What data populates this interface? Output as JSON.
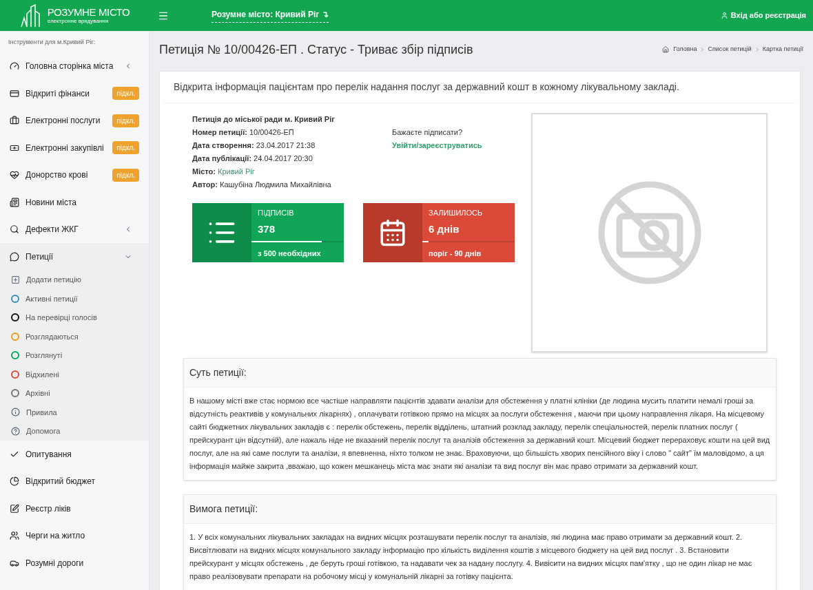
{
  "header": {
    "logo_title": "РОЗУМНЕ МІСТО",
    "logo_subtitle": "електронне врядування",
    "city_selector": "Розумне місто: Кривий Ріг",
    "city_selector_arrow": "↴",
    "login": "Вхід або реєстрація"
  },
  "sidebar": {
    "caption": "Інструменти для м.Кривий Ріг:",
    "items": [
      {
        "label": "Головна сторінка міста",
        "expanded": false
      },
      {
        "label": "Відкриті фінанси",
        "badge": "підкл."
      },
      {
        "label": "Електронні послуги",
        "badge": "підкл."
      },
      {
        "label": "Електронні закупівлі",
        "badge": "підкл."
      },
      {
        "label": "Донорство крові",
        "badge": "підкл."
      },
      {
        "label": "Новини міста"
      },
      {
        "label": "Дефекти ЖКГ",
        "expanded": false
      },
      {
        "label": "Петиції",
        "expanded": true,
        "children": [
          {
            "kind": "add",
            "label": "Додати петицію"
          },
          {
            "kind": "status",
            "label": "Активні петиції",
            "color": "#3c8dbc"
          },
          {
            "kind": "status",
            "label": "На перевірці голосів",
            "color": "#111111"
          },
          {
            "kind": "status",
            "label": "Розглядаються",
            "color": "#f39c12"
          },
          {
            "kind": "status",
            "label": "Розглянуті",
            "color": "#00a65a"
          },
          {
            "kind": "status",
            "label": "Відхилені",
            "color": "#dd4b39"
          },
          {
            "kind": "status",
            "label": "Архівні",
            "color": "#777777"
          },
          {
            "kind": "info",
            "label": "Привила"
          },
          {
            "kind": "help",
            "label": "Допомога"
          }
        ]
      },
      {
        "label": "Опитування"
      },
      {
        "label": "Відкритий бюджет"
      },
      {
        "label": "Реєстр ліків"
      },
      {
        "label": "Черги на житло"
      },
      {
        "label": "Розумні дороги"
      }
    ]
  },
  "page": {
    "title": "Петиція № 10/00426-ЕП . Статус - Триває збір підписів",
    "breadcrumbs": [
      "Головна",
      "Список петицій",
      "Картка петиції"
    ]
  },
  "petition": {
    "heading": "Відкрита інформація пацієнтам про перелік надання послуг за державний кошт в кожному лікувальному закладі.",
    "addressee": "Петиція до міської ради м. Кривий Ріг",
    "fields": [
      {
        "label": "Номер петиції:",
        "value": "10/00426-ЕП",
        "link": false
      },
      {
        "label": "Дата створення:",
        "value": "23.04.2017 21:38",
        "link": false
      },
      {
        "label": "Дата публікації:",
        "value": "24.04.2017 20:30",
        "link": false
      },
      {
        "label": "Місто:",
        "value": "Кривий Ріг",
        "link": true
      },
      {
        "label": "Автор:",
        "value": "Кашубіна Людмила Михайлівна",
        "link": false
      }
    ],
    "sign_prompt": "Бажаєте підписати?",
    "sign_link": "Увійти/зареєструватись",
    "stats": [
      {
        "kind": "signatures",
        "title": "ПІДПИСІВ",
        "value": "378",
        "level": 0.76,
        "note": "з 500 необхідних"
      },
      {
        "kind": "days",
        "title": "ЗАЛИШИЛОСЬ",
        "value": "6 днів",
        "level": 0.07,
        "note": "поріг - 90 днів"
      }
    ],
    "sections": [
      {
        "title": "Суть петиції:",
        "text": "В нашому місті вже стає нормою все частіше направляти пацієнтів здавати аналізи для обстеження у платні клініки (де людина мусить платити немалі гроші за відсутність реактивів у комунальних лікарнях) , оплачувати готівкою прямо на місцях за послуги обстеження , маючи при цьому направлення лікаря. На місцевому сайті бюджетних лікувальних закладів є : перелік обстежень, перелік відділень, штатний розклад закладу, перелік спеціальностей, перелік платних послуг ( прейскурант цін відсутній), але нажаль ніде не вказаний перелік послуг та аналізів обстеження за державний кошт. Місцевий бюджет перераховує кошти на цей вид послуг, але на які саме послуги та аналізи, я впевненна, ніхто толком не знає. Враховуючи, що більшість хворих пенсійного віку і слово \" сайт\" їм маловідомо, а ця інформація майже закрита ,вважаю, що кожен мешканець міста має знати які аналізи та вид послуг він має право отримати за державний кошт."
      },
      {
        "title": "Вимога петиції:",
        "text": "1. У всіх комунальних лікувальних закладах на видних місцях розташувати перелік послуг та аналізів, які людина має право отримати за державний кошт. 2. Висвітлювати на видних місцях комунального закладу інформацію про кількість виділення коштів з місцевого бюджету на цей вид послуг . 3. Встановити прейскурант у місцях обстежень , де беруть гроші готівкою, та надавати чек за надану послугу. 4. Вивісити на видних місцях пам'ятку , що не один лікар не має право реалізовувати препарати на робочому місці у комунальній лікарні за готівку пацієнта."
      }
    ]
  }
}
